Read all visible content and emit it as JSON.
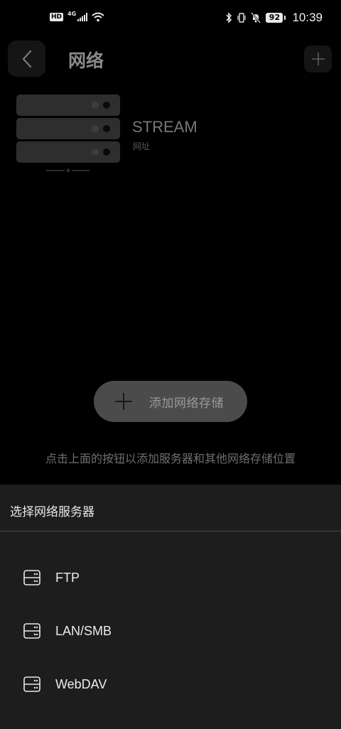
{
  "status_bar": {
    "hd": "HD",
    "network": "4G",
    "battery": "92",
    "time": "10:39"
  },
  "header": {
    "title": "网络",
    "back_icon": "chevron-left-icon",
    "add_icon": "plus-icon"
  },
  "server": {
    "name": "STREAM",
    "subtitle": "网址"
  },
  "add_storage": {
    "label": "添加网络存储"
  },
  "hint": "点击上面的按钮以添加服务器和其他网络存储位置",
  "sheet": {
    "title": "选择网络服务器",
    "options": [
      {
        "label": "FTP",
        "icon": "server-icon"
      },
      {
        "label": "LAN/SMB",
        "icon": "server-icon"
      },
      {
        "label": "WebDAV",
        "icon": "server-icon"
      }
    ]
  }
}
